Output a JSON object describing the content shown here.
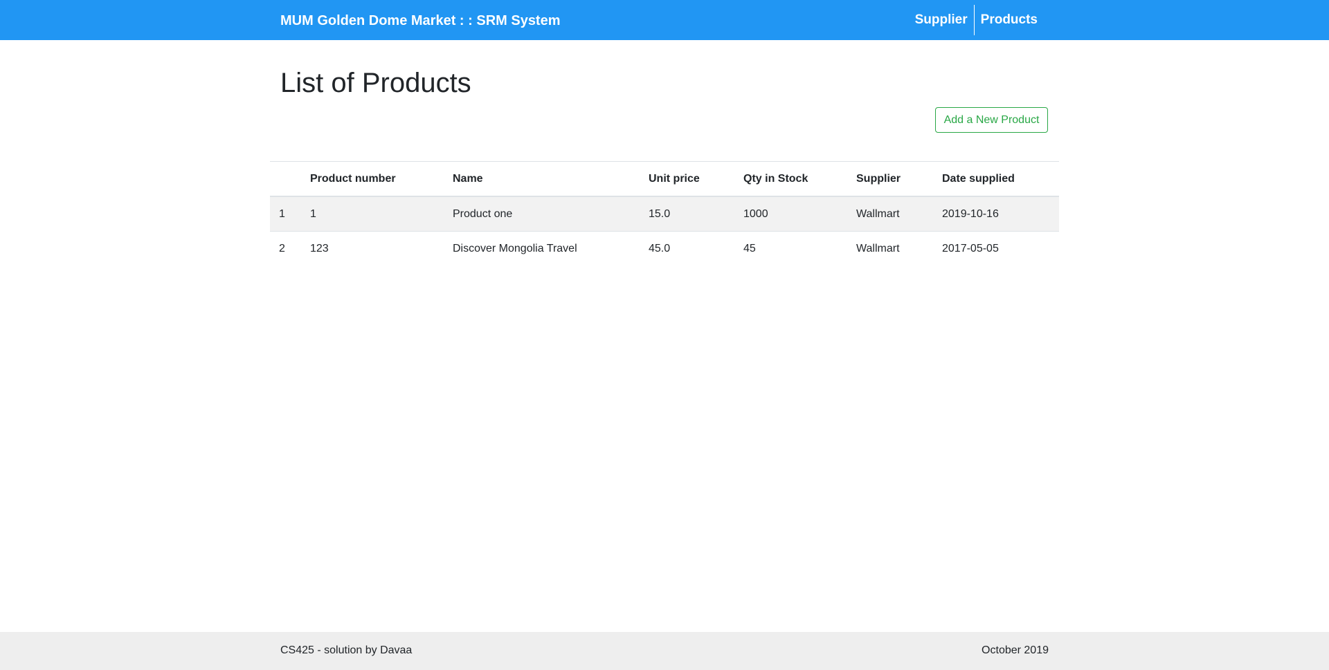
{
  "navbar": {
    "brand": "MUM Golden Dome Market : : SRM System",
    "links": [
      {
        "label": "Supplier"
      },
      {
        "label": "Products"
      }
    ]
  },
  "main": {
    "title": "List of Products",
    "add_button_label": "Add a New Product"
  },
  "table": {
    "columns": [
      "",
      "Product number",
      "Name",
      "Unit price",
      "Qty in Stock",
      "Supplier",
      "Date supplied"
    ],
    "rows": [
      {
        "index": "1",
        "product_number": "1",
        "name": "Product one",
        "unit_price": "15.0",
        "qty": "1000",
        "supplier": "Wallmart",
        "date": "2019-10-16"
      },
      {
        "index": "2",
        "product_number": "123",
        "name": "Discover Mongolia Travel",
        "unit_price": "45.0",
        "qty": "45",
        "supplier": "Wallmart",
        "date": "2017-05-05"
      }
    ]
  },
  "footer": {
    "left": "CS425 - solution by Davaa",
    "right": "October 2019"
  },
  "colors": {
    "navbar_bg": "#2196f3",
    "success": "#28a745",
    "footer_bg": "#eeeeee",
    "row_stripe": "#f2f2f2"
  }
}
